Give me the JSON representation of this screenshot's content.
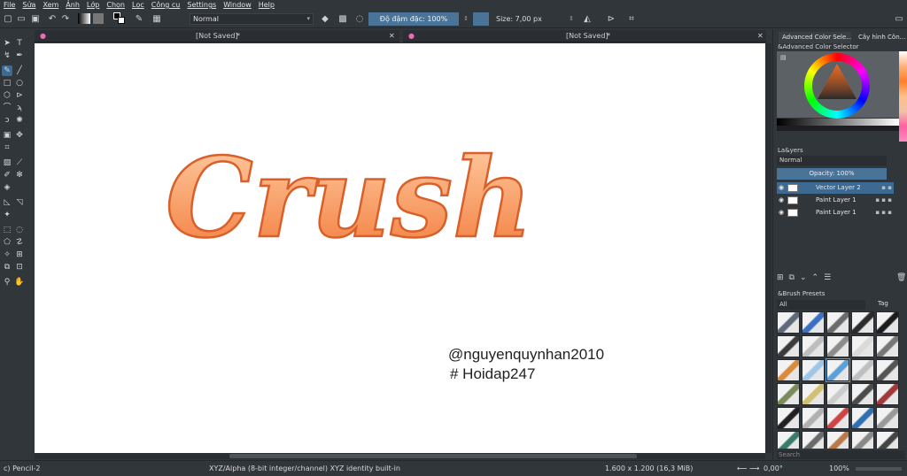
{
  "menu": [
    "File",
    "Sửa",
    "Xem",
    "Ảnh",
    "Lớp",
    "Chọn",
    "Lọc",
    "Công cụ",
    "Settings",
    "Window",
    "Help"
  ],
  "toolbar": {
    "blend_mode": "Normal",
    "opacity_label": "Độ đậm đặc: 100%",
    "size_label": "Size: 7,00 px"
  },
  "tabs": {
    "left_title": "[Not Saved]",
    "left_star": "*",
    "right_title": "[Not Saved]",
    "right_star": "*"
  },
  "canvas": {
    "word": "Crush",
    "handle": "@nguyenquynhan2010",
    "hashtag": "# Hoidap247"
  },
  "docker": {
    "tab1": "Advanced Color Sele...",
    "tab2": "Cây hình Côn...",
    "color_selector_title": "&Advanced Color Selector",
    "layers_title": "La&yers",
    "layers_blend": "Normal",
    "layers_opacity": "Opacity:  100%",
    "layers": [
      {
        "name": "Vector Layer 2",
        "selected": true
      },
      {
        "name": "Paint Layer 1",
        "selected": false
      },
      {
        "name": "Paint Layer 1",
        "selected": false
      }
    ],
    "brush_presets_title": "&Brush Presets",
    "brush_filter": "All",
    "brush_tag": "Tag",
    "search_placeholder": "Search"
  },
  "status": {
    "brush": "c) Pencil-2",
    "colorspace": "XYZ/Alpha (8-bit integer/channel)  XYZ identity built-in",
    "dimensions": "1.600 x 1.200 (16,3 MiB)",
    "rotation": "0,00°",
    "zoom": "100%"
  },
  "colors": {
    "accent": "#4a7398",
    "crush_light": "#ffc39a",
    "crush_dark": "#f06b2a"
  }
}
